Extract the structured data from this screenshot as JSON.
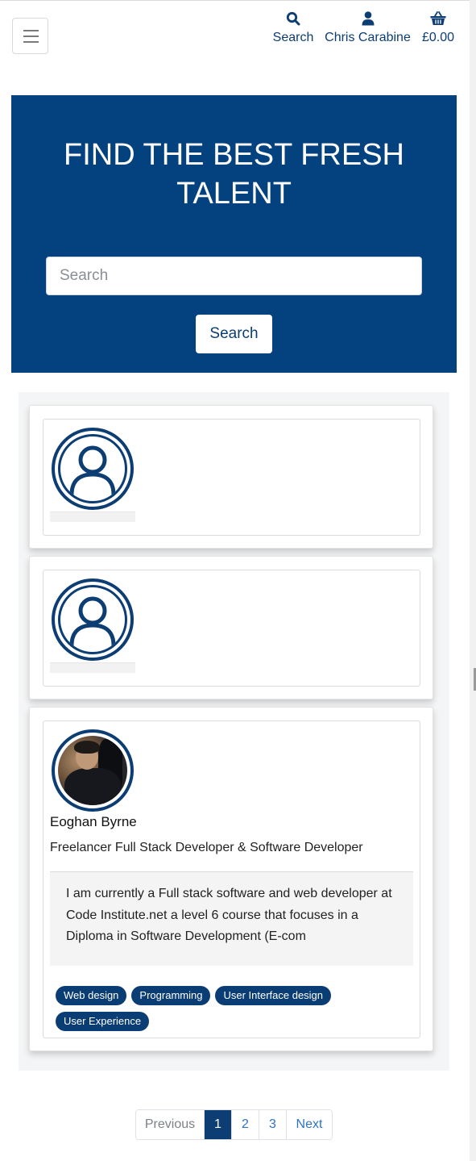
{
  "header": {
    "menu_icon": "hamburger-icon",
    "nav": [
      {
        "label": "Search",
        "icon": "search-icon"
      },
      {
        "label": "Chris Carabine",
        "icon": "user-icon"
      },
      {
        "label": "£0.00",
        "icon": "basket-icon"
      }
    ]
  },
  "hero": {
    "title": "FIND THE BEST FRESH TALENT",
    "search_placeholder": "Search",
    "search_button": "Search",
    "background": "#03427f"
  },
  "profiles": [
    {
      "avatar": "default-avatar-icon"
    },
    {
      "avatar": "default-avatar-icon"
    },
    {
      "avatar": "profile-photo",
      "name": "Eoghan Byrne",
      "title": "Freelancer Full Stack Developer & Software Developer",
      "bio": "I am currently a Full stack software and web developer at Code Institute.net a level 6 course that focuses in a Diploma in Software Development (E-com",
      "tags": [
        "Web design",
        "Programming",
        "User Interface design",
        "User Experience"
      ]
    }
  ],
  "pagination": {
    "previous": "Previous",
    "pages": [
      "1",
      "2",
      "3"
    ],
    "current": "1",
    "next": "Next"
  },
  "colors": {
    "brand": "#0c3d73",
    "link": "#2f74c0"
  }
}
